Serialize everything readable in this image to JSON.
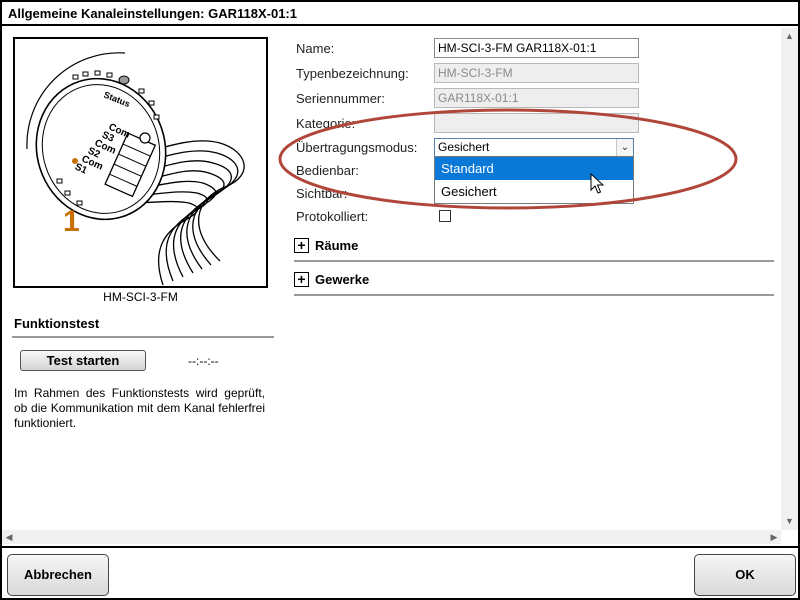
{
  "window": {
    "title": "Allgemeine Kanaleinstellungen: GAR118X-01:1"
  },
  "device": {
    "caption": "HM-SCI-3-FM",
    "channel_number": "1",
    "labels": {
      "status": "Status",
      "com_s3": "Com\nS3",
      "com_s2": "Com\nS2",
      "com_s1": "Com\nS1"
    },
    "accent_color": "#c87000"
  },
  "function_test": {
    "title": "Funktionstest",
    "button_label": "Test starten",
    "time": "--:--:--",
    "description": "Im Rahmen des Funktionstests wird geprüft, ob die Kommunikation mit dem Kanal fehlerfrei funktioniert."
  },
  "form": {
    "name": {
      "label": "Name:",
      "value": "HM-SCI-3-FM GAR118X-01:1"
    },
    "type": {
      "label": "Typenbezeichnung:",
      "value": "HM-SCI-3-FM"
    },
    "serial": {
      "label": "Seriennummer:",
      "value": "GAR118X-01:1"
    },
    "category": {
      "label": "Kategorie:",
      "value": ""
    },
    "transfer_mode": {
      "label": "Übertragungsmodus:",
      "value": "Gesichert",
      "options": [
        "Standard",
        "Gesichert"
      ],
      "highlighted_option": "Standard"
    },
    "operable": {
      "label": "Bedienbar:"
    },
    "visible": {
      "label": "Sichtbar:"
    },
    "logged": {
      "label": "Protokolliert:"
    }
  },
  "expanders": {
    "rooms": "Räume",
    "trades": "Gewerke"
  },
  "footer": {
    "cancel_label": "Abbrechen",
    "ok_label": "OK"
  },
  "colors": {
    "selection": "#0a78d7",
    "highlight_oval": "#b0463a"
  }
}
